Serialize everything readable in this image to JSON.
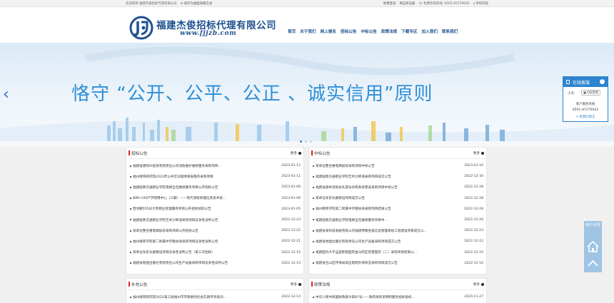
{
  "topbar": {
    "welcome": "欢迎来到 福建杰俊招标代理有限公司",
    "save_desktop": "保存为桌面快捷方式",
    "register": "免费登录",
    "supplier_register": "供应商注册",
    "hotline_label": "免费咨询热线:",
    "hotline": "0591-87279932",
    "mobile": "手机浏览"
  },
  "header": {
    "company_name": "福建杰俊招标代理有限公司",
    "url": "www.fjjzb.com",
    "brand_color": "#1f5190"
  },
  "nav": [
    "首页",
    "关于我们",
    "网上报名",
    "招标公告",
    "中标公告",
    "政策法规",
    "下载专区",
    "加入我们",
    "联系我们"
  ],
  "banner": {
    "slogan": "恪守 “公开、公平、公正 、诚实信用”原则",
    "prev_icon": "chevron-left-icon"
  },
  "panels": {
    "tender": {
      "title": "招标公告",
      "more": "更多",
      "items": [
        {
          "title": "福建省建阳兴投资有限责任公司消防维护维修服务采购项目...",
          "date": "2023-01-12"
        },
        {
          "title": "福州教育研究院2023年公共实训基地保安服务采购项目",
          "date": "2023-01-11"
        },
        {
          "title": "福建船政交通职业学院电梯全包维保服务项目公开招标公告",
          "date": "2023-01-09"
        },
        {
          "title": "BIM+GIS产学研用中心（三期）——现代测绘地理信息技术技...",
          "date": "2023-01-09"
        },
        {
          "title": "西洪路555号大院物业管理服务项目公开招标招标公告",
          "date": "2023-01-05"
        },
        {
          "title": "福建船政交通职业学院艺术沙降墙采购项目竞争性谈判公告",
          "date": "2022-12-23"
        },
        {
          "title": "某单位整合楼电梯加装采购项目公开招标公告",
          "date": "2022-12-22"
        },
        {
          "title": "福州教育学院第二附属中学膳食承采购项目竞争性谈判公告",
          "date": "2022-12-21"
        },
        {
          "title": "某单位军史长廊建设项目竞争性谈判公告（第三次招标）",
          "date": "2022-12-15"
        },
        {
          "title": "福建省地图出版社有限责任公司生产设备采购项目竞争性谈判公告",
          "date": "2022-12-15"
        }
      ]
    },
    "award": {
      "title": "中标公告",
      "more": "更多",
      "items": [
        {
          "title": "某单位整合楼电梯加装采购项目中标公告",
          "date": "2023-01-16"
        },
        {
          "title": "福建船政交通职业学院艺术沙降墙采购项目成交公告",
          "date": "2022-12-30"
        },
        {
          "title": "福建省森林消防总队游泳训练系统建设采购项目中标公告",
          "date": "2022-12-28"
        },
        {
          "title": "某单位军史长廊建设项目成交公告",
          "date": "2022-12-28"
        },
        {
          "title": "福州教育学院第二附属中学膳食承采购项目结果公告",
          "date": "2022-12-28"
        },
        {
          "title": "福建船政交通职业学院电梯全包维保服务项目中...",
          "date": "2022-12-26"
        },
        {
          "title": "福建省某科技发展有限公司福建恭敬各类信息管理系统工程建设项目成交公...",
          "date": "2022-12-23"
        },
        {
          "title": "福建省地图出版社有限责任公司生产设备采购项目成交公告",
          "date": "2022-12-22"
        },
        {
          "title": "福建医科大学孟超肝胆医院金山院区智慧医院（二）采购项目结果公...",
          "date": "2022-12-19"
        },
        {
          "title": "福建省台山区环境局高压电网外修改造采购项目成交公告",
          "date": "2022-12-16"
        }
      ]
    },
    "supplement": {
      "title": "补充公告",
      "more": "更多",
      "items": [
        {
          "title": "福州教育研究院2022第三批福州市市政教师社会实践专项培训...",
          "date": "2022-12-14"
        }
      ]
    },
    "policy": {
      "title": "政策法规",
      "more": "更多",
      "items": [
        {
          "title": "中华人民共和国财政部令第87号——政府采购货物和服务招标投标...",
          "date": "2020-11-27"
        }
      ]
    }
  },
  "service": {
    "title": "在线客服",
    "prefix": "小杰:",
    "qq_label": "QQ咨询",
    "service_hotline_label": "客户服务热线",
    "hotline": "0591-87279932",
    "leave_message": "给我们留言"
  },
  "side": {
    "feedback": "用户反馈",
    "home_icon": "home-icon",
    "top_icon": "arrow-up-icon"
  },
  "colors": {
    "accent_blue": "#2e84d0",
    "slogan_blue": "#2f8fd6",
    "marker_red": "#dd2222"
  }
}
